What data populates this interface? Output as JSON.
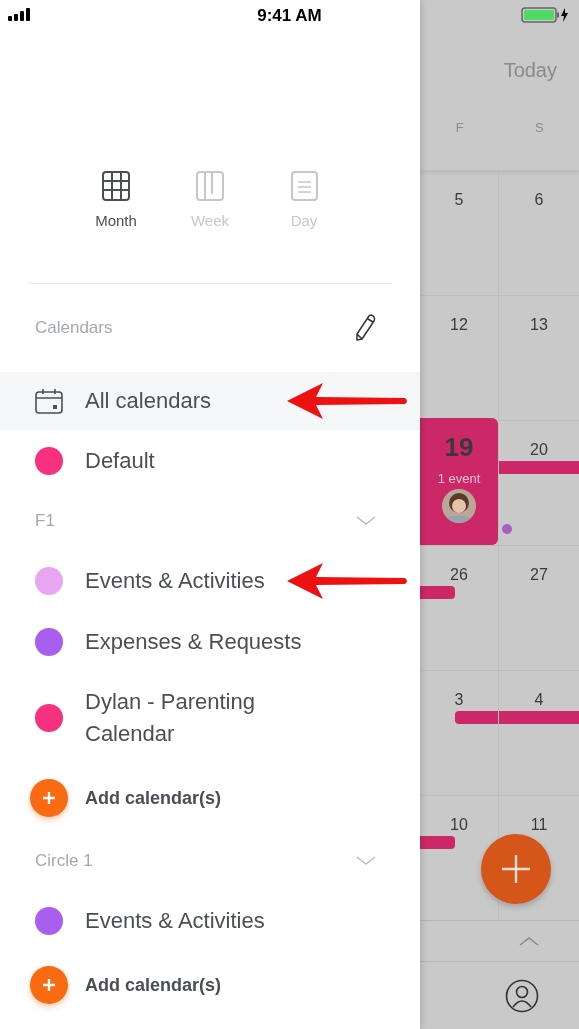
{
  "status_bar": {
    "time": "9:41 AM"
  },
  "view_switcher": [
    {
      "label": "Month",
      "kind": "month",
      "selected": true
    },
    {
      "label": "Week",
      "kind": "week",
      "selected": false
    },
    {
      "label": "Day",
      "kind": "day",
      "selected": false
    }
  ],
  "calendars_header": {
    "title": "Calendars"
  },
  "all_calendars": {
    "label": "All calendars",
    "selected": true,
    "annotated": true
  },
  "calendars": [
    {
      "label": "Default",
      "color": "#f7317f",
      "annotated": false
    }
  ],
  "groups": [
    {
      "title": "F1",
      "calendars": [
        {
          "label": "Events & Activities",
          "color": "#e8a6f2",
          "annotated": true
        },
        {
          "label": "Expenses & Requests",
          "color": "#a95ef0",
          "annotated": false
        },
        {
          "label": "Dylan - Parenting Calendar",
          "color": "#f7317f",
          "annotated": false
        }
      ],
      "add_label": "Add calendar(s)"
    },
    {
      "title": "Circle 1",
      "calendars": [
        {
          "label": "Events & Activities",
          "color": "#a95ef0",
          "annotated": false
        }
      ],
      "add_label": "Add calendar(s)"
    }
  ],
  "backdrop": {
    "today": "Today",
    "weekdays": [
      "F",
      "S"
    ],
    "weeks": [
      [
        {
          "day": "5",
          "selected": false
        },
        {
          "day": "6",
          "selected": false
        }
      ],
      [
        {
          "day": "12",
          "selected": false
        },
        {
          "day": "13",
          "selected": false
        }
      ],
      [
        {
          "day": "19",
          "selected": true,
          "events": "1 event"
        },
        {
          "day": "20",
          "selected": false,
          "event_bar": true,
          "bar_starts": false,
          "bar_ends": false,
          "dot": true
        }
      ],
      [
        {
          "day": "26",
          "selected": false,
          "event_bar": true,
          "bar_starts": false,
          "bar_ends": true
        },
        {
          "day": "27",
          "selected": false
        }
      ],
      [
        {
          "day": "3",
          "selected": false,
          "event_bar": true,
          "bar_starts": true,
          "bar_ends": false
        },
        {
          "day": "4",
          "selected": false,
          "event_bar": true,
          "bar_starts": false,
          "bar_ends": false
        }
      ],
      [
        {
          "day": "10",
          "selected": false,
          "event_bar": true,
          "bar_starts": false,
          "bar_ends": true
        },
        {
          "day": "11",
          "selected": false
        }
      ]
    ]
  }
}
